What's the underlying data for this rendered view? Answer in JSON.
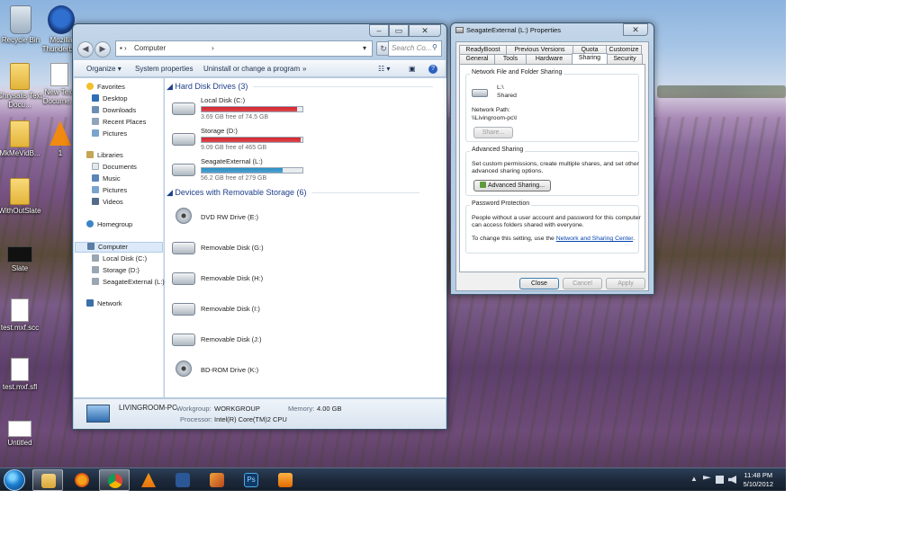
{
  "desktop": {
    "icons": [
      {
        "label": "Recycle Bin"
      },
      {
        "label": "Mozilla Thunderbi..."
      },
      {
        "label": "Chrysalis Text Docu..."
      },
      {
        "label": "New Text Docume..."
      },
      {
        "label": "MkMeVidB..."
      },
      {
        "label": "1"
      },
      {
        "label": "WithOutSlate"
      },
      {
        "label": "Slate"
      },
      {
        "label": "test.mxf.scc"
      },
      {
        "label": "test.mxf.sfl"
      },
      {
        "label": "Untitled"
      }
    ]
  },
  "explorer": {
    "address": {
      "path": "Computer",
      "search_placeholder": "Search Co..."
    },
    "commands": {
      "organize": "Organize",
      "system_properties": "System properties",
      "uninstall": "Uninstall or change a program",
      "more": "»"
    },
    "nav": {
      "favorites": "Favorites",
      "favorites_items": [
        "Desktop",
        "Downloads",
        "Recent Places",
        "Pictures"
      ],
      "libraries": "Libraries",
      "libraries_items": [
        "Documents",
        "Music",
        "Pictures",
        "Videos"
      ],
      "homegroup": "Homegroup",
      "computer": "Computer",
      "computer_items": [
        "Local Disk (C:)",
        "Storage (D:)",
        "SeagateExternal (L:)"
      ],
      "network": "Network"
    },
    "hard_disk_group": "Hard Disk Drives (3)",
    "hard_disks": [
      {
        "name": "Local Disk (C:)",
        "free": "3.69 GB free of 74.5 GB",
        "used_fraction": 0.95,
        "bar_color": "#d5232b"
      },
      {
        "name": "Storage (D:)",
        "free": "9.09 GB free of 465 GB",
        "used_fraction": 0.98,
        "bar_color": "#d5232b"
      },
      {
        "name": "SeagateExternal (L:)",
        "free": "56.2 GB free of 279 GB",
        "used_fraction": 0.8,
        "bar_color": "#2a8fc6"
      }
    ],
    "removable_group": "Devices with Removable Storage (6)",
    "removable": [
      {
        "name": "DVD RW Drive (E:)"
      },
      {
        "name": "Removable Disk (G:)"
      },
      {
        "name": "Removable Disk (H:)"
      },
      {
        "name": "Removable Disk (I:)"
      },
      {
        "name": "Removable Disk (J:)"
      },
      {
        "name": "BD-ROM Drive (K:)"
      }
    ],
    "details": {
      "pc_name": "LIVINGROOM-PC",
      "workgroup_label": "Workgroup:",
      "workgroup": "WORKGROUP",
      "memory_label": "Memory:",
      "memory": "4.00 GB",
      "processor_label": "Processor:",
      "processor": "Intel(R) Core(TM)2 CPU"
    }
  },
  "props": {
    "title": "SeagateExternal (L:) Properties",
    "tabs_row1": [
      "ReadyBoost",
      "Previous Versions",
      "Quota",
      "Customize"
    ],
    "tabs_row2": [
      "General",
      "Tools",
      "Hardware",
      "Sharing",
      "Security"
    ],
    "network_sharing_title": "Network File and Folder Sharing",
    "drive_label": "L:\\",
    "shared_status": "Shared",
    "network_path_label": "Network Path:",
    "network_path": "\\\\Livingroom-pc\\l",
    "share_button": "Share...",
    "advanced_title": "Advanced Sharing",
    "advanced_desc1": "Set custom permissions, create multiple shares, and set other",
    "advanced_desc2": "advanced sharing options.",
    "advanced_button": "Advanced Sharing...",
    "password_title": "Password Protection",
    "password_desc1": "People without a user account and password for this computer",
    "password_desc2": "can access folders shared with everyone.",
    "password_desc3": "To change this setting, use the",
    "password_link": "Network and Sharing Center",
    "password_desc3_end": ".",
    "close_button": "Close",
    "cancel_button": "Cancel",
    "apply_button": "Apply"
  },
  "taskbar": {
    "time": "11:48 PM",
    "date": "5/10/2012"
  }
}
